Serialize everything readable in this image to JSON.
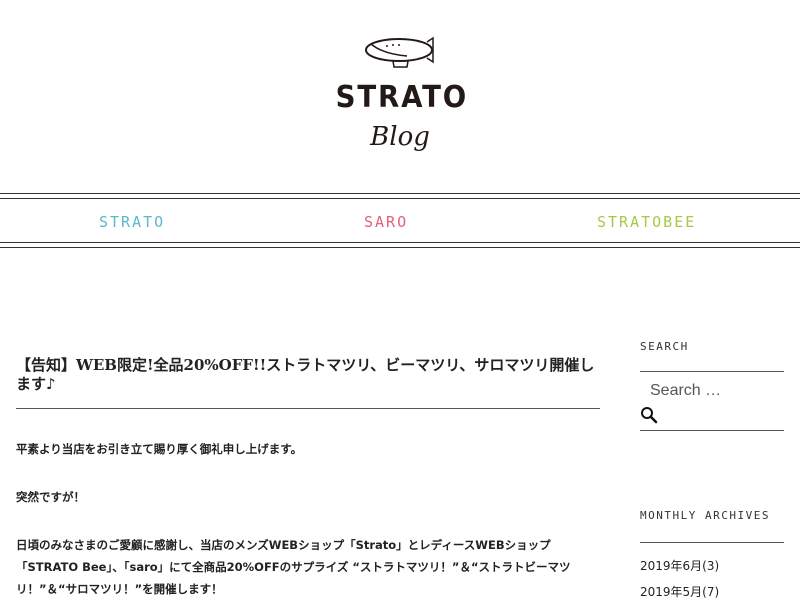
{
  "header": {
    "logo_text": "STRATO",
    "logo_subtext": "Blog"
  },
  "nav": {
    "items": [
      {
        "label": "STRATO",
        "color": "#5bb9c9"
      },
      {
        "label": "SARO",
        "color": "#e0607f"
      },
      {
        "label": "STRATOBEE",
        "color": "#a8c84a"
      }
    ]
  },
  "post": {
    "title": "【告知】WEB限定!全品20%OFF!!ストラトマツリ、ビーマツリ、サロマツリ開催します♪",
    "paragraphs": [
      "平素より当店をお引き立て賜り厚く御礼申し上げます。",
      "突然ですが！",
      "日頃のみなさまのご愛顧に感謝し、当店のメンズWEBショップ「Strato」とレディースWEBショップ「STRATO Bee」、「saro」にて全商品20%OFFのサプライズ “ストラトマツリ！”＆“ストラトビーマツリ！”＆“サロマツリ！”を開催します！"
    ]
  },
  "sidebar": {
    "search_title": "SEARCH",
    "search_placeholder": "Search …",
    "archives_title": "MONTHLY ARCHIVES",
    "archives": [
      "2019年6月(3)",
      "2019年5月(7)"
    ]
  }
}
